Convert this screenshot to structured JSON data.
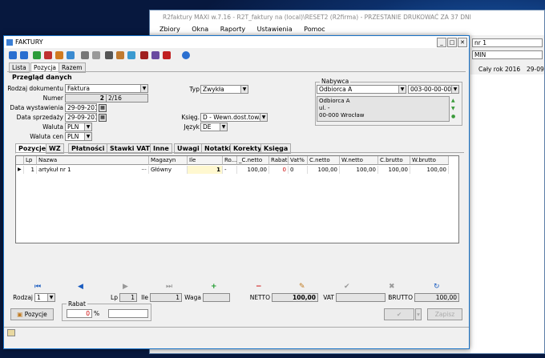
{
  "background_window": {
    "title": "R2faktury MAXI w.7.16 - R2T_faktury na (local)\\RESET2 (R2firma) - PRZESTANIE DRUKOWAĆ ZA 37 DNI",
    "menu": [
      "Zbiory",
      "Okna",
      "Raporty",
      "Ustawienia",
      "Pomoc"
    ],
    "right_field1": "nr 1",
    "right_field2": "MIN",
    "right_label": "Cały rok 2016",
    "right_date": "29-09"
  },
  "window": {
    "title": "FAKTURY"
  },
  "tabs": [
    "Lista",
    "Pozycja",
    "Razem"
  ],
  "section_title": "Przegląd danych",
  "form": {
    "rodzaj_label": "Rodzaj dokumentu",
    "rodzaj_value": "Faktura",
    "numer_label": "Numer",
    "numer_value": "2",
    "numer_suffix": "2/16",
    "data_wyst_label": "Data wystawienia",
    "data_wyst_value": "29-09-2016",
    "data_sprz_label": "Data sprzedaży",
    "data_sprz_value": "29-09-2016",
    "waluta_label": "Waluta",
    "waluta_value": "PLN",
    "waluta_cen_label": "Waluta cen",
    "waluta_cen_value": "PLN",
    "typ_label": "Typ",
    "typ_value": "Zwykła",
    "ksieg_label": "Księg.",
    "ksieg_value": "D - Wewn.dost.tow.",
    "jezyk_label": "Język",
    "jezyk_value": "DE"
  },
  "nabywca": {
    "label": "Nabywca",
    "name": "Odbiorca A",
    "code": "003-00-00-000",
    "address": [
      "Odbiorca A",
      "ul. -",
      "00-000 Wrocław"
    ]
  },
  "subtabs": [
    "Pozycje",
    "WZ",
    "Płatności",
    "Stawki VAT",
    "Inne",
    "Uwagi",
    "Notatki",
    "Korekty",
    "Księga"
  ],
  "grid": {
    "headers": [
      "Lp",
      "Nazwa",
      "Magazyn",
      "Ile",
      "Ro...",
      "_C.netto",
      "Rabat",
      "Vat%",
      "C.netto",
      "W.netto",
      "C.brutto",
      "W.brutto"
    ],
    "rows": [
      {
        "lp": "1",
        "nazwa": "artykuł nr 1",
        "mag": "Główny",
        "ile": "1",
        "ro": "-",
        "cnetto0": "100,00",
        "rabat": "0",
        "vat": "0",
        "cnetto": "100,00",
        "wnetto": "100,00",
        "cbrutto": "100,00",
        "wbrutto": "100,00"
      }
    ]
  },
  "footer": {
    "rodzaj_label": "Rodzaj",
    "rodzaj_value": "1",
    "lp_label": "Lp",
    "lp_value": "1",
    "ile_label": "Ile",
    "ile_value": "1",
    "waga_label": "Waga",
    "netto_label": "NETTO",
    "netto_value": "100,00",
    "vat_label": "VAT",
    "brutto_label": "BRUTTO",
    "brutto_value": "100,00",
    "rabat_label": "Rabat",
    "rabat_value": "0",
    "rabat_unit": "%",
    "pozycje_button": "Pozycje",
    "zapisz_button": "Zapisz"
  }
}
